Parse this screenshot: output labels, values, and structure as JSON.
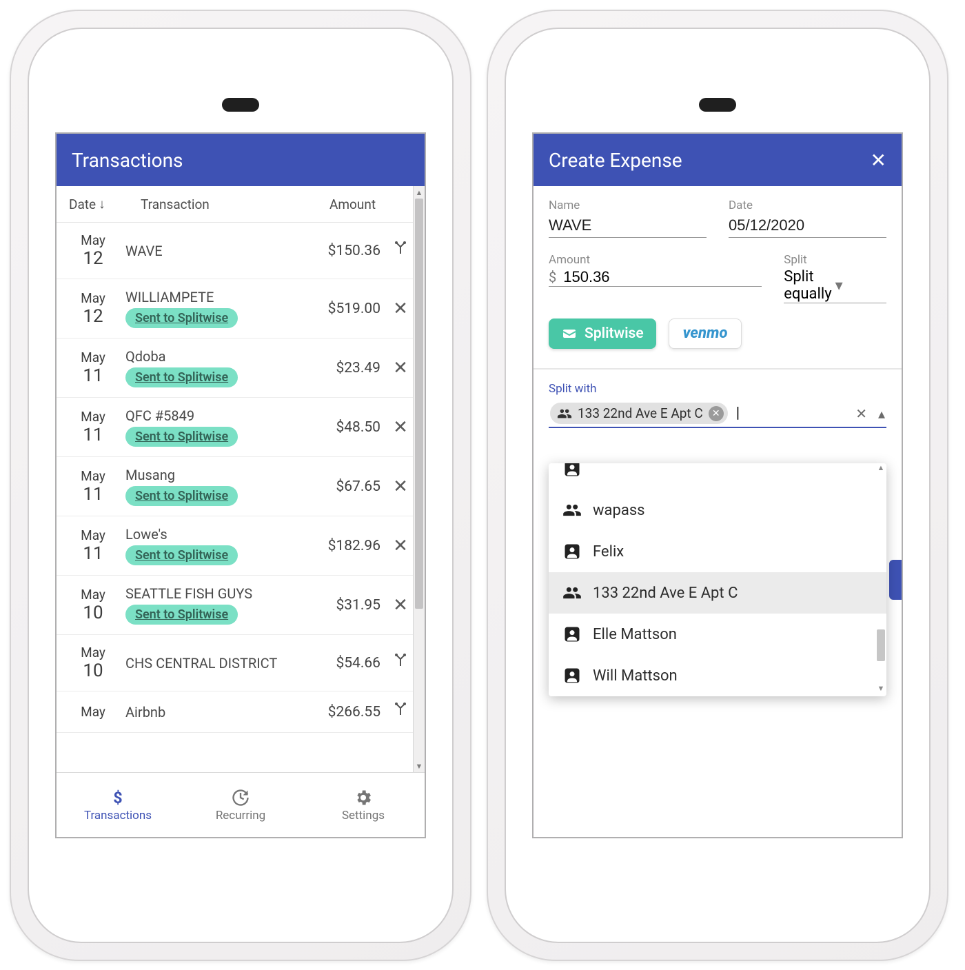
{
  "left": {
    "title": "Transactions",
    "columns": {
      "date": "Date",
      "tx": "Transaction",
      "amount": "Amount"
    },
    "sent_badge": "Sent to Splitwise",
    "rows": [
      {
        "month": "May",
        "day": "12",
        "name": "WAVE",
        "amount": "$150.36",
        "badge": false,
        "action": "split"
      },
      {
        "month": "May",
        "day": "12",
        "name": "WILLIAMPETE",
        "amount": "$519.00",
        "badge": true,
        "action": "x"
      },
      {
        "month": "May",
        "day": "11",
        "name": "Qdoba",
        "amount": "$23.49",
        "badge": true,
        "action": "x"
      },
      {
        "month": "May",
        "day": "11",
        "name": "QFC #5849",
        "amount": "$48.50",
        "badge": true,
        "action": "x"
      },
      {
        "month": "May",
        "day": "11",
        "name": "Musang",
        "amount": "$67.65",
        "badge": true,
        "action": "x"
      },
      {
        "month": "May",
        "day": "11",
        "name": "Lowe's",
        "amount": "$182.96",
        "badge": true,
        "action": "x"
      },
      {
        "month": "May",
        "day": "10",
        "name": "SEATTLE FISH GUYS",
        "amount": "$31.95",
        "badge": true,
        "action": "x"
      },
      {
        "month": "May",
        "day": "10",
        "name": "CHS CENTRAL DISTRICT",
        "amount": "$54.66",
        "badge": false,
        "action": "split"
      },
      {
        "month": "May",
        "day": "",
        "name": "Airbnb",
        "amount": "$266.55",
        "badge": false,
        "action": "split"
      }
    ],
    "nav": {
      "transactions": "Transactions",
      "recurring": "Recurring",
      "settings": "Settings"
    }
  },
  "right": {
    "title": "Create Expense",
    "fields": {
      "name_label": "Name",
      "name_value": "WAVE",
      "date_label": "Date",
      "date_value": "05/12/2020",
      "amount_label": "Amount",
      "amount_currency": "$",
      "amount_value": "150.36",
      "split_label": "Split",
      "split_value": "Split equally"
    },
    "buttons": {
      "splitwise": "Splitwise",
      "venmo": "venmo"
    },
    "split_with_label": "Split with",
    "chip_text": "133 22nd Ave E Apt C",
    "options": [
      {
        "type": "group",
        "label": "wapass"
      },
      {
        "type": "person",
        "label": "Felix"
      },
      {
        "type": "group",
        "label": "133 22nd Ave E Apt C",
        "selected": true
      },
      {
        "type": "person",
        "label": "Elle Mattson"
      },
      {
        "type": "person",
        "label": "Will Mattson"
      }
    ]
  }
}
